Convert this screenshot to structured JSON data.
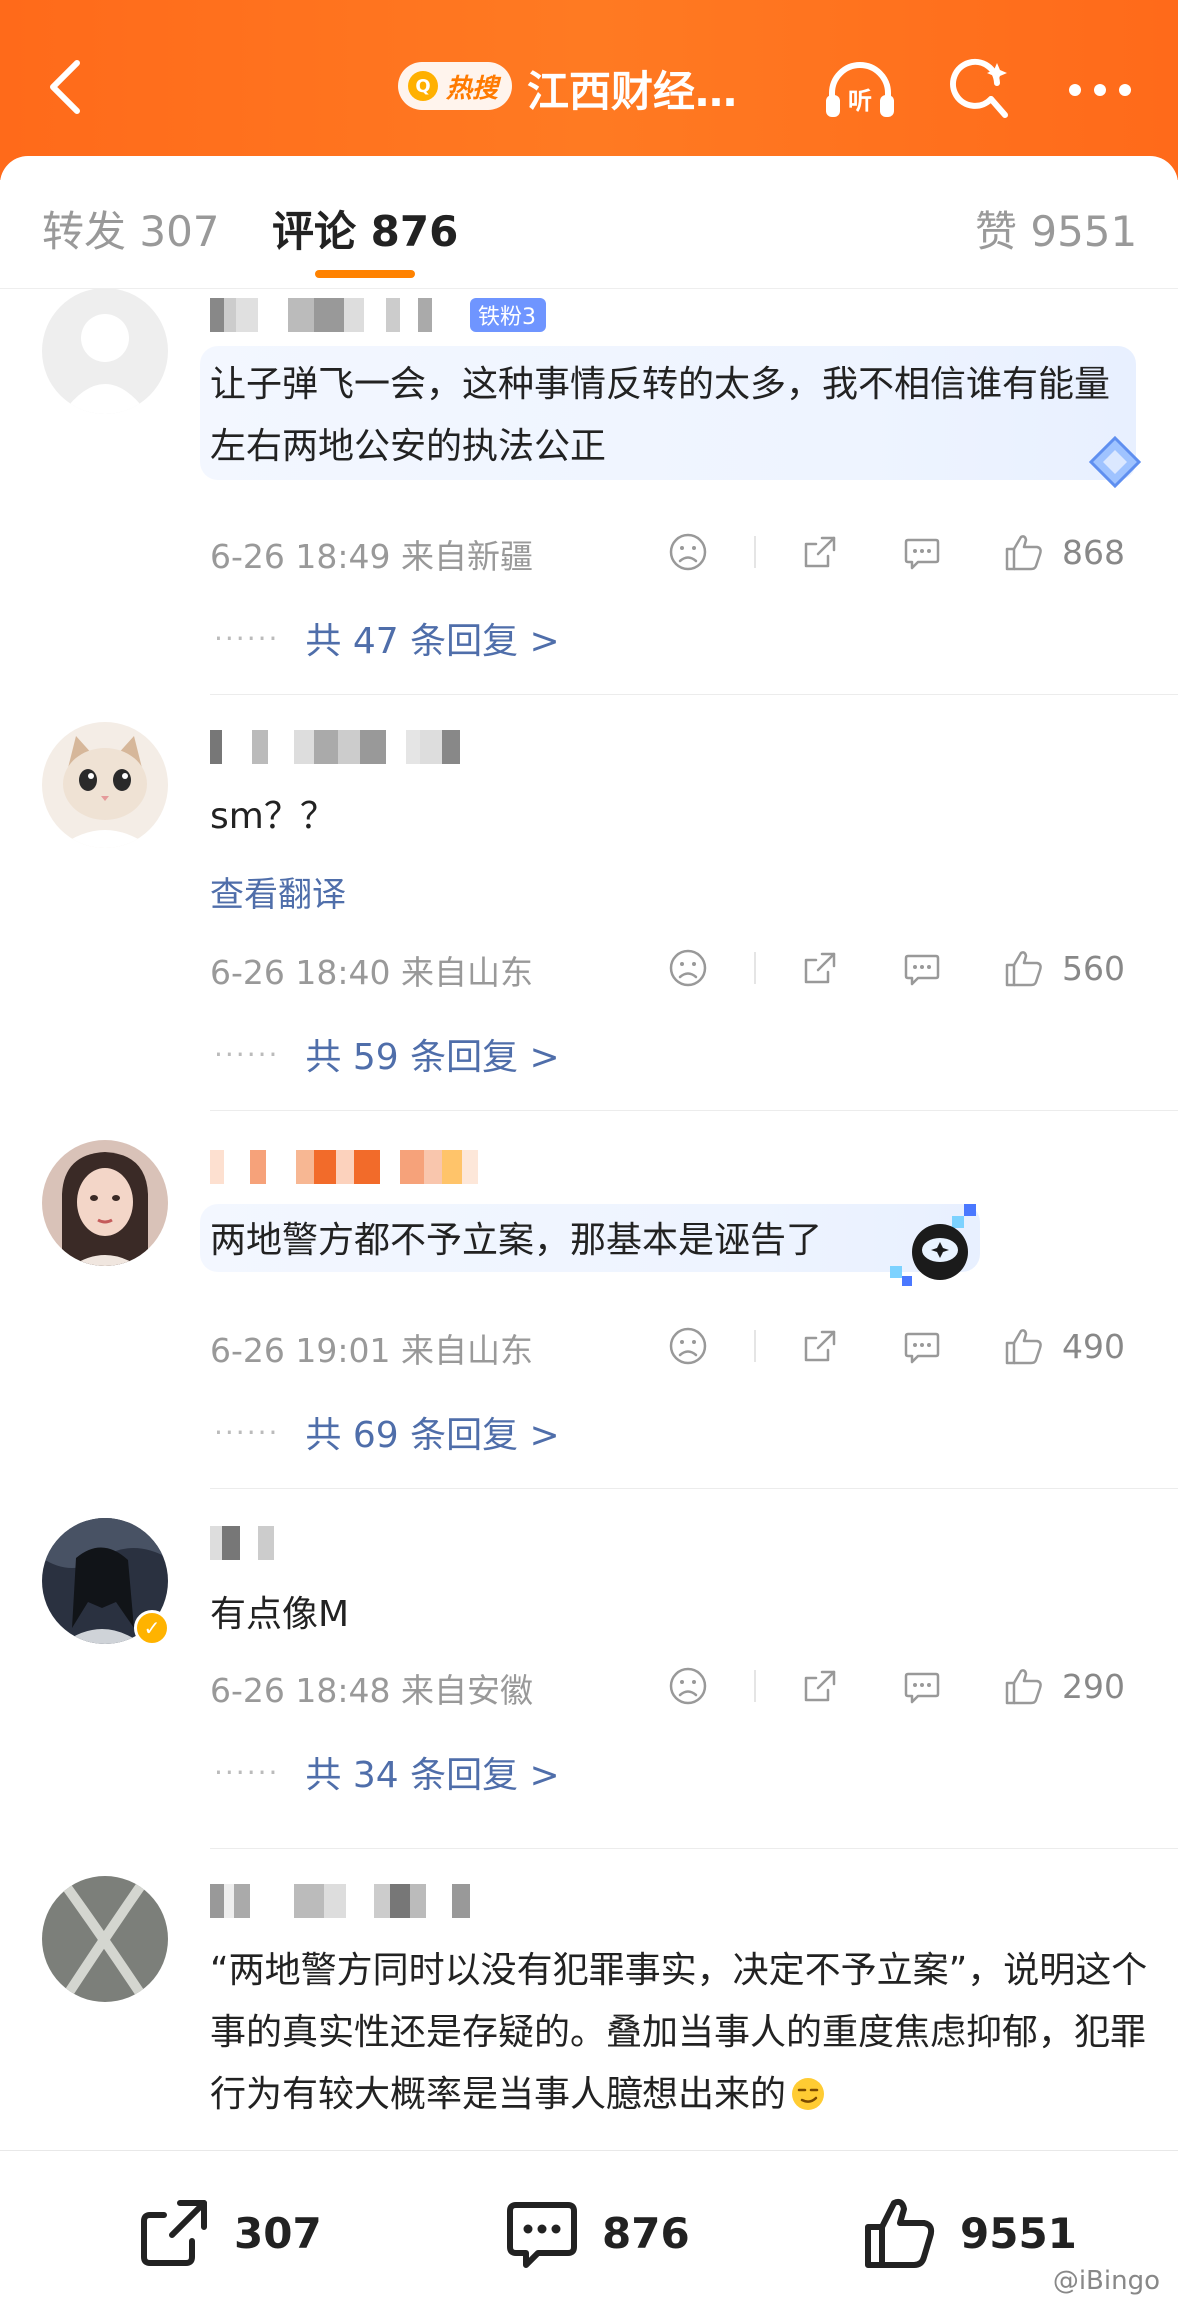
{
  "header": {
    "hot_label": "热搜",
    "title": "江西财经…",
    "icons": [
      "back-icon",
      "listen-icon",
      "search-sparkle-icon",
      "more-icon"
    ],
    "listen_label": "听"
  },
  "tabs": [
    {
      "label": "转发 307"
    },
    {
      "label": "评论 876"
    },
    {
      "label": "赞 9551"
    }
  ],
  "comments": [
    {
      "badge": "铁粉3",
      "text": "让子弹飞一会，这种事情反转的太多，我不相信谁有能量左右两地公安的执法公正",
      "meta": "6-26 18:49 来自新疆",
      "likes": "868",
      "replies": "共 47 条回复 >"
    },
    {
      "text": "sm？？",
      "translate": "查看翻译",
      "meta": "6-26 18:40 来自山东",
      "likes": "560",
      "replies": "共 59 条回复 >"
    },
    {
      "text": "两地警方都不予立案，那基本是诬告了",
      "meta": "6-26 19:01 来自山东",
      "likes": "490",
      "replies": "共 69 条回复 >"
    },
    {
      "text": "有点像M",
      "meta": "6-26 18:48 来自安徽",
      "likes": "290",
      "replies": "共 34 条回复 >"
    },
    {
      "text": "“两地警方同时以没有犯罪事实，决定不予立案”，说明这个事的真实性还是存疑的。叠加当事人的重度焦虑抑郁，犯罪行为有较大概率是当事人臆想出来的"
    }
  ],
  "bottom": {
    "repost": "307",
    "comment": "876",
    "like": "9551"
  },
  "watermark": "@iBingo",
  "colors": {
    "accent": "#ff8200",
    "link": "#4f6eaa",
    "topbar": "#ff6a1a"
  }
}
